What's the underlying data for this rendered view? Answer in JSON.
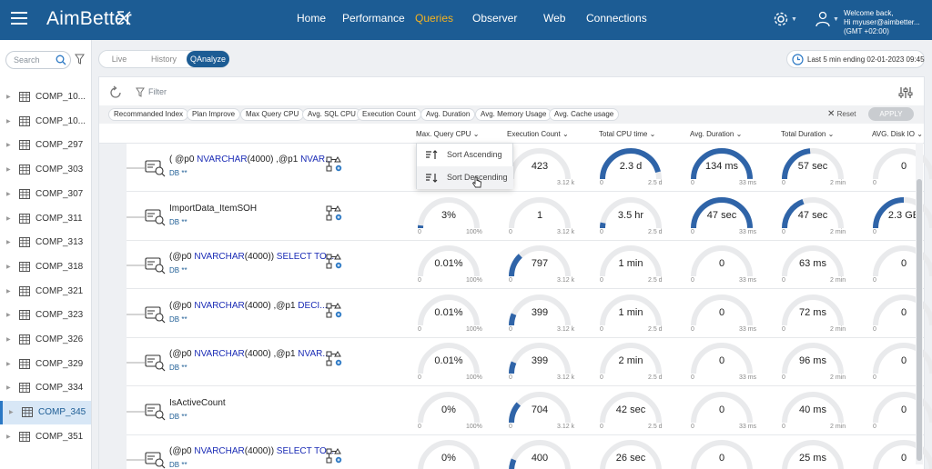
{
  "app": {
    "brand": "AimBetter",
    "nav": [
      {
        "label": "Home"
      },
      {
        "label": "Performance"
      },
      {
        "label": "Queries"
      },
      {
        "label": "Observer"
      },
      {
        "label": "Web"
      },
      {
        "label": "Connections"
      }
    ],
    "active_nav": "Queries",
    "welcome_line1": "Welcome back,",
    "welcome_line2": "Hi myuser@aimbetter...",
    "welcome_line3": "(GMT +02:00)",
    "accent_color": "#1c5c94",
    "active_nav_color": "#f5b320"
  },
  "sidebar": {
    "search_placeholder": "Search",
    "items": [
      {
        "label": "COMP_10..."
      },
      {
        "label": "COMP_10..."
      },
      {
        "label": "COMP_297"
      },
      {
        "label": "COMP_303"
      },
      {
        "label": "COMP_307"
      },
      {
        "label": "COMP_311"
      },
      {
        "label": "COMP_313"
      },
      {
        "label": "COMP_318"
      },
      {
        "label": "COMP_321"
      },
      {
        "label": "COMP_323"
      },
      {
        "label": "COMP_326"
      },
      {
        "label": "COMP_329"
      },
      {
        "label": "COMP_334"
      },
      {
        "label": "COMP_345"
      },
      {
        "label": "COMP_351"
      }
    ],
    "active_item": "COMP_345"
  },
  "modes": {
    "tabs": [
      {
        "label": "Live"
      },
      {
        "label": "History"
      },
      {
        "label": "QAnalyze"
      }
    ],
    "active": "QAnalyze"
  },
  "time_range": "Last 5 min ending  02-01-2023 09:45",
  "toolbar": {
    "filter_label": "Filter",
    "chips": [
      {
        "label": "Recommanded Index"
      },
      {
        "label": "Plan Improve"
      },
      {
        "label": "Max Query CPU"
      },
      {
        "label": "Avg. SQL CPU"
      },
      {
        "label": "Execution Count"
      },
      {
        "label": "Avg. Duration"
      },
      {
        "label": "Avg. Memory Usage"
      },
      {
        "label": "Avg. Cache usage"
      }
    ],
    "reset_label": "Reset",
    "apply_label": "APPLY"
  },
  "columns": [
    {
      "label": "Max. Query CPU"
    },
    {
      "label": "Execution Count"
    },
    {
      "label": "Total CPU time"
    },
    {
      "label": "Avg. Duration"
    },
    {
      "label": "Total Duration"
    },
    {
      "label": "AVG. Disk IO"
    }
  ],
  "sort_menu": {
    "ascending": "Sort Ascending",
    "descending": "Sort Descending"
  },
  "gauge_min": "0",
  "gauge_max": [
    "100%",
    "3.12 k",
    "2.5 d",
    "33 ms",
    "2 min",
    ""
  ],
  "rows": [
    {
      "title_parts": [
        "( @p0 ",
        "NVARCHAR",
        "(4000) ,@p1 ",
        "NVAR..."
      ],
      "db": "DB **",
      "gauges": [
        {
          "value": "",
          "fill": 0
        },
        {
          "value": "423",
          "fill": 0.0
        },
        {
          "value": "2.3 d",
          "fill": 0.92
        },
        {
          "value": "134 ms",
          "fill": 1.0
        },
        {
          "value": "57 sec",
          "fill": 0.47
        },
        {
          "value": "0",
          "fill": 0
        }
      ]
    },
    {
      "title_parts": [
        "ImportData_ItemSOH",
        "",
        "",
        ""
      ],
      "db": "DB **",
      "gauges": [
        {
          "value": "3%",
          "fill": 0.03
        },
        {
          "value": "1",
          "fill": 0.0
        },
        {
          "value": "3.5 hr",
          "fill": 0.06
        },
        {
          "value": "47 sec",
          "fill": 1.0
        },
        {
          "value": "47 sec",
          "fill": 0.39
        },
        {
          "value": "2.3 GB",
          "fill": 0.5
        }
      ]
    },
    {
      "title_parts": [
        "(@p0 ",
        "NVARCHAR",
        "(4000)) ",
        "SELECT TO..."
      ],
      "db": "DB **",
      "gauges": [
        {
          "value": "0.01%",
          "fill": 0
        },
        {
          "value": "797",
          "fill": 0.26
        },
        {
          "value": "1 min",
          "fill": 0
        },
        {
          "value": "0",
          "fill": 0
        },
        {
          "value": "63 ms",
          "fill": 0
        },
        {
          "value": "0",
          "fill": 0
        }
      ]
    },
    {
      "title_parts": [
        "(@p0 ",
        "NVARCHAR",
        "(4000) ,@p1 ",
        "DECI..."
      ],
      "db": "DB **",
      "gauges": [
        {
          "value": "0.01%",
          "fill": 0
        },
        {
          "value": "399",
          "fill": 0.13
        },
        {
          "value": "1 min",
          "fill": 0
        },
        {
          "value": "0",
          "fill": 0
        },
        {
          "value": "72 ms",
          "fill": 0
        },
        {
          "value": "0",
          "fill": 0
        }
      ]
    },
    {
      "title_parts": [
        "(@p0 ",
        "NVARCHAR",
        "(4000) ,@p1 ",
        "NVAR..."
      ],
      "db": "DB **",
      "gauges": [
        {
          "value": "0.01%",
          "fill": 0
        },
        {
          "value": "399",
          "fill": 0.13
        },
        {
          "value": "2 min",
          "fill": 0
        },
        {
          "value": "0",
          "fill": 0
        },
        {
          "value": "96 ms",
          "fill": 0
        },
        {
          "value": "0",
          "fill": 0
        }
      ]
    },
    {
      "title_parts": [
        "IsActiveCount",
        "",
        "",
        ""
      ],
      "db": "DB **",
      "gauges": [
        {
          "value": "0%",
          "fill": 0
        },
        {
          "value": "704",
          "fill": 0.23
        },
        {
          "value": "42 sec",
          "fill": 0
        },
        {
          "value": "0",
          "fill": 0
        },
        {
          "value": "40 ms",
          "fill": 0
        },
        {
          "value": "0",
          "fill": 0
        }
      ]
    },
    {
      "title_parts": [
        "(@p0 ",
        "NVARCHAR",
        "(4000)) ",
        "SELECT TO..."
      ],
      "db": "DB **",
      "gauges": [
        {
          "value": "0%",
          "fill": 0
        },
        {
          "value": "400",
          "fill": 0.13
        },
        {
          "value": "26 sec",
          "fill": 0
        },
        {
          "value": "0",
          "fill": 0
        },
        {
          "value": "25 ms",
          "fill": 0
        },
        {
          "value": "0",
          "fill": 0
        }
      ]
    }
  ]
}
